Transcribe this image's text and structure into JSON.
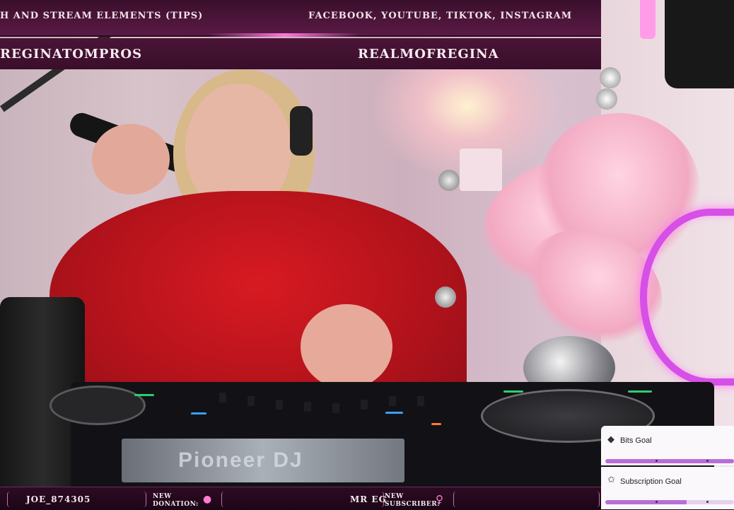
{
  "header": {
    "left_text": "H AND STREAM ELEMENTS (TIPS)",
    "right_text": "FACEBOOK, YOUTUBE, TIKTOK, INSTAGRAM"
  },
  "names": {
    "left": "REGINATOMPROS",
    "right": "REALMOFREGINA"
  },
  "deck": {
    "brand": "Pioneer DJ"
  },
  "ticker": {
    "latest_donor": "JOE_874305",
    "donation_label_1": "NEW",
    "donation_label_2": "DONATION:",
    "latest_subscriber": "MR EG",
    "subscriber_label_1": "NEW",
    "subscriber_label_2": "SUBSCRIBER:"
  },
  "goals": [
    {
      "title": "Bits Goal",
      "icon": "bits-icon",
      "progress": 1.0
    },
    {
      "title": "Subscription Goal",
      "icon": "sub-star-icon",
      "progress": 0.63
    }
  ],
  "colors": {
    "banner": "#4a1436",
    "accent": "#ff78dc",
    "goal_fill": "#b96ed6"
  }
}
